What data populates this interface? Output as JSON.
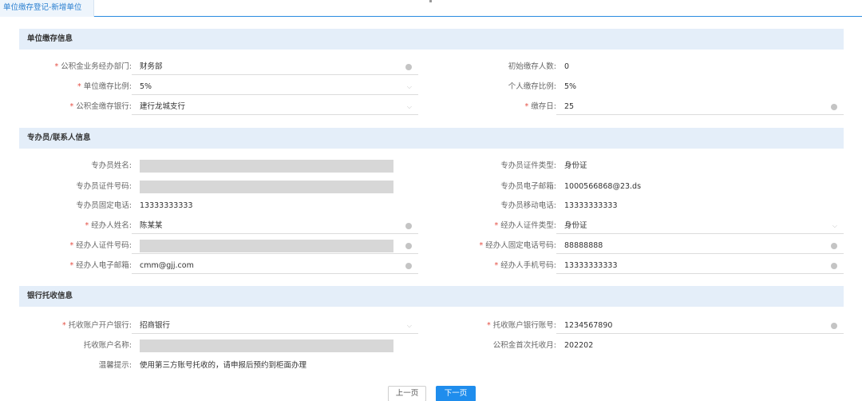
{
  "tab": {
    "label": "单位缴存登记-新增单位"
  },
  "sections": {
    "unit": {
      "title": "单位缴存信息"
    },
    "contact": {
      "title": "专办员/联系人信息"
    },
    "bank": {
      "title": "银行托收信息"
    }
  },
  "unit": {
    "dept_label": "公积金业务经办部门:",
    "dept_value": "财务部",
    "init_count_label": "初始缴存人数:",
    "init_count_value": "0",
    "unit_ratio_label": "单位缴存比例:",
    "unit_ratio_value": "5%",
    "personal_ratio_label": "个人缴存比例:",
    "personal_ratio_value": "5%",
    "bank_label": "公积金缴存银行:",
    "bank_value": "建行龙城支行",
    "day_label": "缴存日:",
    "day_value": "25"
  },
  "contact": {
    "agent_name_label": "专办员姓名:",
    "agent_id_type_label": "专办员证件类型:",
    "agent_id_type_value": "身份证",
    "agent_id_no_label": "专办员证件号码:",
    "agent_email_label": "专办员电子邮箱:",
    "agent_email_value": "1000566868@23.ds",
    "agent_fixed_label": "专办员固定电话:",
    "agent_fixed_value": "13333333333",
    "agent_mobile_label": "专办员移动电话:",
    "agent_mobile_value": "13333333333",
    "handler_name_label": "经办人姓名:",
    "handler_name_value": "陈某某",
    "handler_id_type_label": "经办人证件类型:",
    "handler_id_type_value": "身份证",
    "handler_id_no_label": "经办人证件号码:",
    "handler_fixed_label": "经办人固定电话号码:",
    "handler_fixed_value": "88888888",
    "handler_email_label": "经办人电子邮箱:",
    "handler_email_value": "cmm@gjj.com",
    "handler_mobile_label": "经办人手机号码:",
    "handler_mobile_value": "13333333333"
  },
  "bank": {
    "open_bank_label": "托收账户开户银行:",
    "open_bank_value": "招商银行",
    "account_no_label": "托收账户银行账号:",
    "account_no_value": "1234567890",
    "account_name_label": "托收账户名称:",
    "first_month_label": "公积金首次托收月:",
    "first_month_value": "202202",
    "tip_label": "温馨提示:",
    "tip_value": "使用第三方账号托收的，请申报后预约到柜面办理"
  },
  "buttons": {
    "prev": "上一页",
    "next": "下一页"
  },
  "required_mark": "*",
  "colors": {
    "accent": "#1f8ded",
    "section_bg": "#e4eef9",
    "required": "#e54d42"
  }
}
